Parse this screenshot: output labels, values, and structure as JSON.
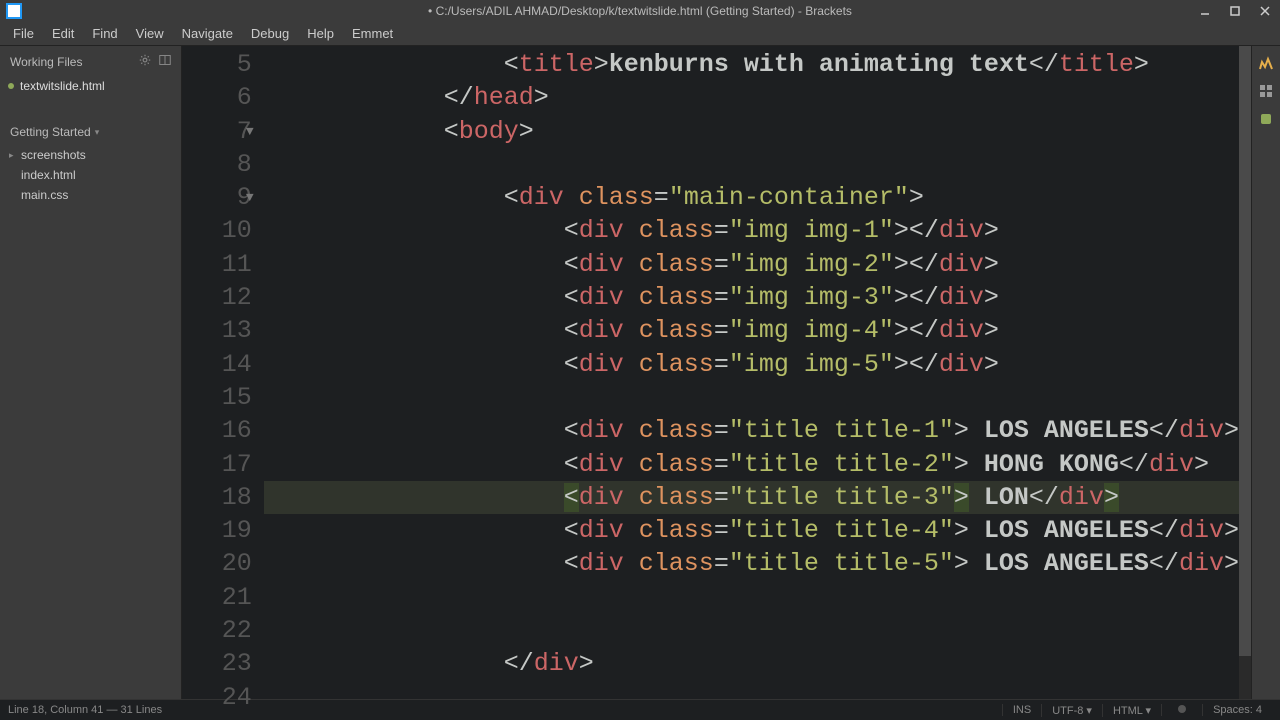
{
  "window": {
    "title": "• C:/Users/ADIL AHMAD/Desktop/k/textwitslide.html (Getting Started) - Brackets"
  },
  "menu": [
    "File",
    "Edit",
    "Find",
    "View",
    "Navigate",
    "Debug",
    "Help",
    "Emmet"
  ],
  "sidebar": {
    "working_files_label": "Working Files",
    "working_files": [
      "textwitslide.html"
    ],
    "project_label": "Getting Started",
    "tree": [
      {
        "name": "screenshots",
        "folder": true
      },
      {
        "name": "index.html",
        "folder": false
      },
      {
        "name": "main.css",
        "folder": false
      }
    ]
  },
  "gutter": {
    "start": 5,
    "end": 24,
    "folds": [
      7,
      9
    ]
  },
  "code": {
    "lines": [
      {
        "n": 5,
        "indent": 3,
        "tokens": [
          [
            "<",
            "bracket"
          ],
          [
            "title",
            "tag"
          ],
          [
            ">",
            "bracket"
          ],
          [
            "kenburns with animating text",
            "text"
          ],
          [
            "</",
            "bracket"
          ],
          [
            "title",
            "tag"
          ],
          [
            ">",
            "bracket"
          ]
        ]
      },
      {
        "n": 6,
        "indent": 2,
        "tokens": [
          [
            "</",
            "bracket"
          ],
          [
            "head",
            "tag"
          ],
          [
            ">",
            "bracket"
          ]
        ]
      },
      {
        "n": 7,
        "indent": 2,
        "tokens": [
          [
            "<",
            "bracket"
          ],
          [
            "body",
            "tag"
          ],
          [
            ">",
            "bracket"
          ]
        ]
      },
      {
        "n": 8,
        "indent": 0,
        "tokens": []
      },
      {
        "n": 9,
        "indent": 3,
        "tokens": [
          [
            "<",
            "bracket"
          ],
          [
            "div ",
            "tag"
          ],
          [
            "class",
            "attr"
          ],
          [
            "=",
            "punc"
          ],
          [
            "\"main-container\"",
            "str"
          ],
          [
            ">",
            "bracket"
          ]
        ]
      },
      {
        "n": 10,
        "indent": 4,
        "tokens": [
          [
            "<",
            "bracket"
          ],
          [
            "div ",
            "tag"
          ],
          [
            "class",
            "attr"
          ],
          [
            "=",
            "punc"
          ],
          [
            "\"img img-1\"",
            "str"
          ],
          [
            "></",
            "bracket"
          ],
          [
            "div",
            "tag"
          ],
          [
            ">",
            "bracket"
          ]
        ]
      },
      {
        "n": 11,
        "indent": 4,
        "tokens": [
          [
            "<",
            "bracket"
          ],
          [
            "div ",
            "tag"
          ],
          [
            "class",
            "attr"
          ],
          [
            "=",
            "punc"
          ],
          [
            "\"img img-2\"",
            "str"
          ],
          [
            "></",
            "bracket"
          ],
          [
            "div",
            "tag"
          ],
          [
            ">",
            "bracket"
          ]
        ]
      },
      {
        "n": 12,
        "indent": 4,
        "tokens": [
          [
            "<",
            "bracket"
          ],
          [
            "div ",
            "tag"
          ],
          [
            "class",
            "attr"
          ],
          [
            "=",
            "punc"
          ],
          [
            "\"img img-3\"",
            "str"
          ],
          [
            "></",
            "bracket"
          ],
          [
            "div",
            "tag"
          ],
          [
            ">",
            "bracket"
          ]
        ]
      },
      {
        "n": 13,
        "indent": 4,
        "tokens": [
          [
            "<",
            "bracket"
          ],
          [
            "div ",
            "tag"
          ],
          [
            "class",
            "attr"
          ],
          [
            "=",
            "punc"
          ],
          [
            "\"img img-4\"",
            "str"
          ],
          [
            "></",
            "bracket"
          ],
          [
            "div",
            "tag"
          ],
          [
            ">",
            "bracket"
          ]
        ]
      },
      {
        "n": 14,
        "indent": 4,
        "tokens": [
          [
            "<",
            "bracket"
          ],
          [
            "div ",
            "tag"
          ],
          [
            "class",
            "attr"
          ],
          [
            "=",
            "punc"
          ],
          [
            "\"img img-5\"",
            "str"
          ],
          [
            "></",
            "bracket"
          ],
          [
            "div",
            "tag"
          ],
          [
            ">",
            "bracket"
          ]
        ]
      },
      {
        "n": 15,
        "indent": 0,
        "tokens": []
      },
      {
        "n": 16,
        "indent": 4,
        "tokens": [
          [
            "<",
            "bracket"
          ],
          [
            "div ",
            "tag"
          ],
          [
            "class",
            "attr"
          ],
          [
            "=",
            "punc"
          ],
          [
            "\"title title-1\"",
            "str"
          ],
          [
            ">",
            "bracket"
          ],
          [
            " LOS ANGELES",
            "text"
          ],
          [
            "</",
            "bracket"
          ],
          [
            "div",
            "tag"
          ],
          [
            ">",
            "bracket"
          ]
        ]
      },
      {
        "n": 17,
        "indent": 4,
        "tokens": [
          [
            "<",
            "bracket"
          ],
          [
            "div ",
            "tag"
          ],
          [
            "class",
            "attr"
          ],
          [
            "=",
            "punc"
          ],
          [
            "\"title title-2\"",
            "str"
          ],
          [
            ">",
            "bracket"
          ],
          [
            " HONG KONG",
            "text"
          ],
          [
            "</",
            "bracket"
          ],
          [
            "div",
            "tag"
          ],
          [
            ">",
            "bracket"
          ]
        ]
      },
      {
        "n": 18,
        "indent": 4,
        "hl": true,
        "tokens": [
          [
            "<",
            "bracket-m"
          ],
          [
            "div ",
            "tag"
          ],
          [
            "class",
            "attr"
          ],
          [
            "=",
            "punc"
          ],
          [
            "\"title title-3\"",
            "str"
          ],
          [
            ">",
            "bracket-m"
          ],
          [
            " LON",
            "text"
          ],
          [
            "</",
            "bracket"
          ],
          [
            "div",
            "tag"
          ],
          [
            ">",
            "bracket-m"
          ]
        ]
      },
      {
        "n": 19,
        "indent": 4,
        "tokens": [
          [
            "<",
            "bracket"
          ],
          [
            "div ",
            "tag"
          ],
          [
            "class",
            "attr"
          ],
          [
            "=",
            "punc"
          ],
          [
            "\"title title-4\"",
            "str"
          ],
          [
            ">",
            "bracket"
          ],
          [
            " LOS ANGELES",
            "text"
          ],
          [
            "</",
            "bracket"
          ],
          [
            "div",
            "tag"
          ],
          [
            ">",
            "bracket"
          ]
        ]
      },
      {
        "n": 20,
        "indent": 4,
        "tokens": [
          [
            "<",
            "bracket"
          ],
          [
            "div ",
            "tag"
          ],
          [
            "class",
            "attr"
          ],
          [
            "=",
            "punc"
          ],
          [
            "\"title title-5\"",
            "str"
          ],
          [
            ">",
            "bracket"
          ],
          [
            " LOS ANGELES",
            "text"
          ],
          [
            "</",
            "bracket"
          ],
          [
            "div",
            "tag"
          ],
          [
            ">",
            "bracket"
          ]
        ]
      },
      {
        "n": 21,
        "indent": 0,
        "tokens": []
      },
      {
        "n": 22,
        "indent": 0,
        "tokens": []
      },
      {
        "n": 23,
        "indent": 3,
        "tokens": [
          [
            "</",
            "bracket"
          ],
          [
            "div",
            "tag"
          ],
          [
            ">",
            "bracket"
          ]
        ]
      },
      {
        "n": 24,
        "indent": 0,
        "tokens": []
      }
    ]
  },
  "status": {
    "cursor": "Line 18, Column 41 — 31 Lines",
    "ins": "INS",
    "encoding": "UTF-8",
    "lang": "HTML",
    "spaces": "Spaces: 4"
  }
}
